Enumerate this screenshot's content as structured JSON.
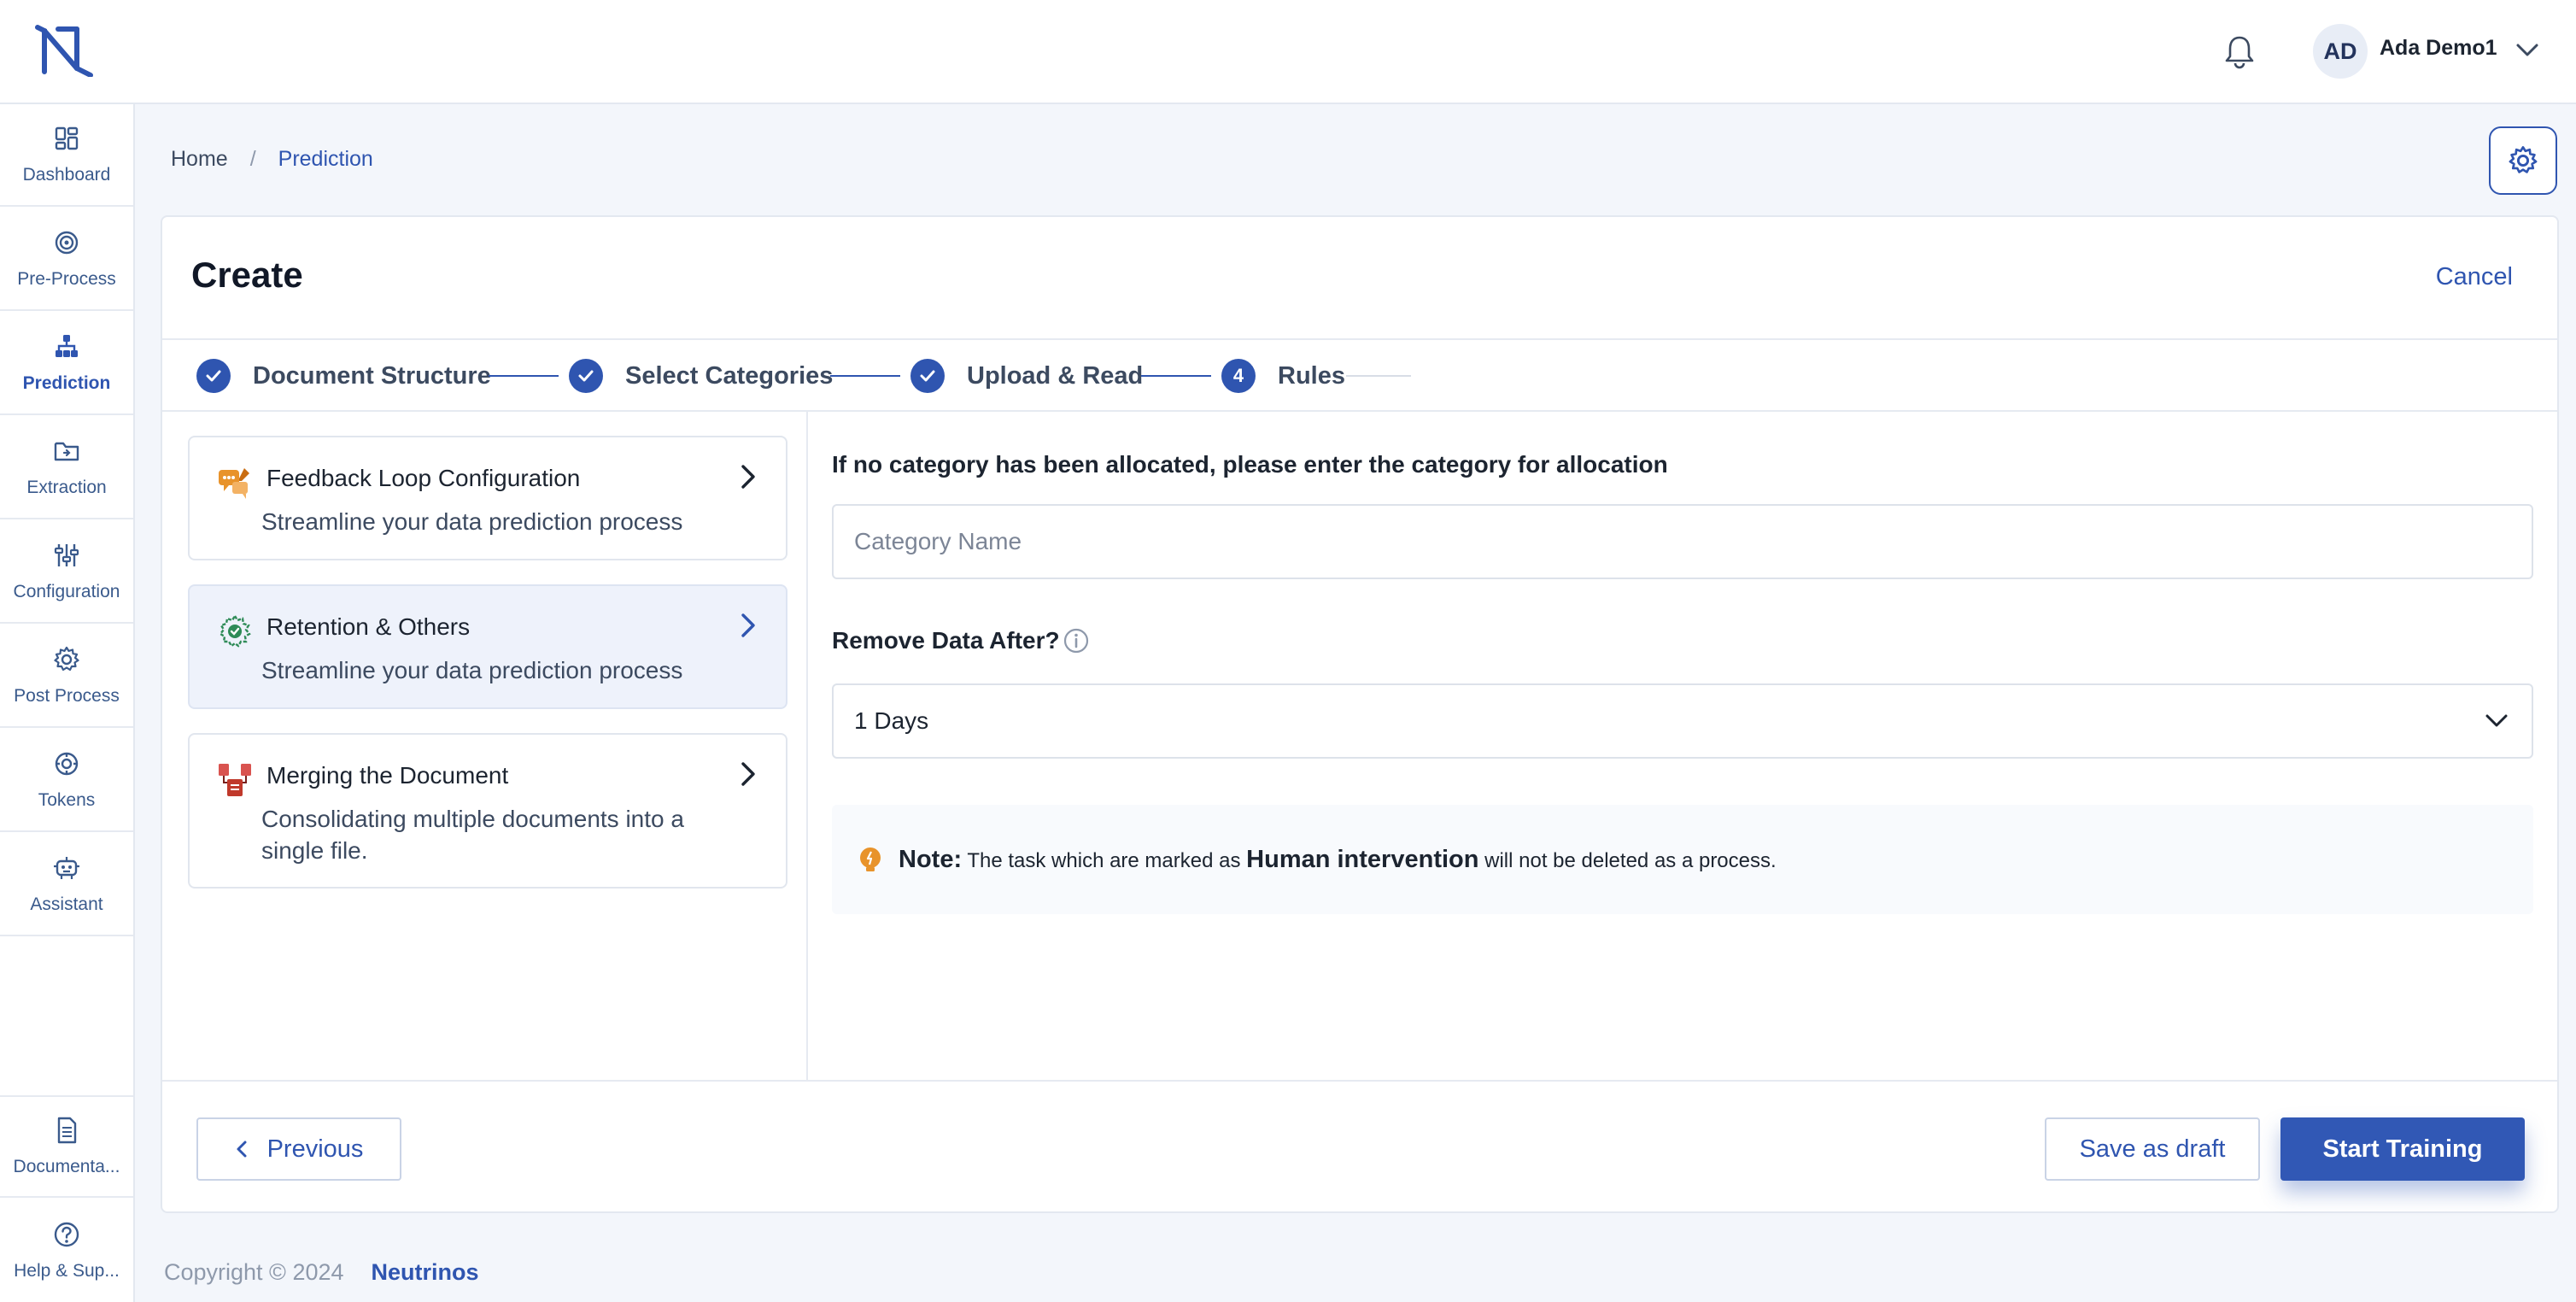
{
  "header": {
    "user_initials": "AD",
    "user_name": "Ada Demo1"
  },
  "sidebar": {
    "items": [
      {
        "label": "Dashboard"
      },
      {
        "label": "Pre-Process"
      },
      {
        "label": "Prediction"
      },
      {
        "label": "Extraction"
      },
      {
        "label": "Configuration"
      },
      {
        "label": "Post Process"
      },
      {
        "label": "Tokens"
      },
      {
        "label": "Assistant"
      }
    ],
    "bottom_items": [
      {
        "label": "Documenta..."
      },
      {
        "label": "Help & Sup..."
      }
    ]
  },
  "breadcrumb": {
    "home": "Home",
    "separator": "/",
    "current": "Prediction"
  },
  "card": {
    "title": "Create",
    "cancel_label": "Cancel"
  },
  "stepper": {
    "steps": [
      {
        "label": "Document Structure",
        "status": "done"
      },
      {
        "label": "Select Categories",
        "status": "done"
      },
      {
        "label": "Upload & Read",
        "status": "done"
      },
      {
        "label": "Rules",
        "status": "current",
        "number": "4"
      }
    ]
  },
  "options": [
    {
      "title": "Feedback Loop Configuration",
      "desc": "Streamline your data prediction process"
    },
    {
      "title": "Retention & Others",
      "desc": "Streamline your data prediction process"
    },
    {
      "title": "Merging the Document",
      "desc": "Consolidating multiple documents into a single file."
    }
  ],
  "form": {
    "category_label": "If no category has been allocated, please enter the category for allocation",
    "category_placeholder": "Category Name",
    "remove_label": "Remove Data After?",
    "remove_value": "1 Days"
  },
  "note": {
    "prefix": "Note:",
    "text_before": "The task which are marked as",
    "highlight": "Human intervention",
    "text_after": "will not be deleted as a process."
  },
  "actions": {
    "previous": "Previous",
    "save_draft": "Save as draft",
    "start_training": "Start Training"
  },
  "footer": {
    "copyright": "Copyright © 2024",
    "brand": "Neutrinos"
  },
  "colors": {
    "accent": "#2f55b0",
    "primary_button": "#3158b5",
    "note_icon": "#e8932b"
  }
}
